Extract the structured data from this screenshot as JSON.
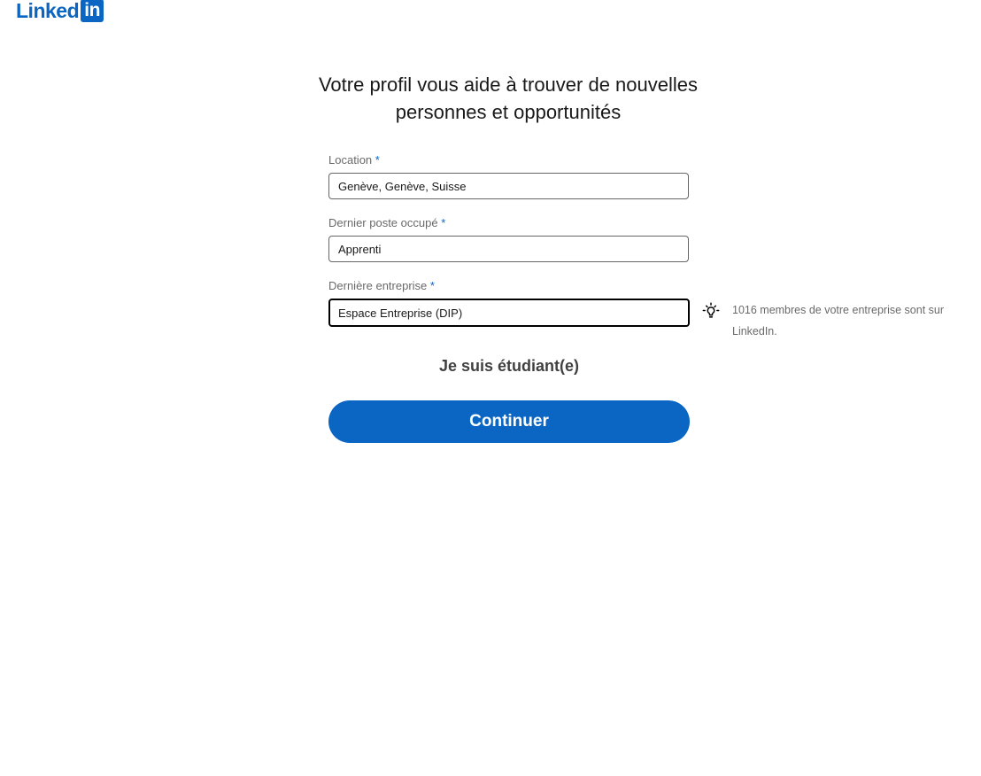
{
  "brand": {
    "word": "Linked",
    "box": "in",
    "color": "#0a66c2"
  },
  "headline": {
    "line1": "Votre profil vous aide à trouver de nouvelles",
    "line2": "personnes et opportunités"
  },
  "form": {
    "location": {
      "label": "Location",
      "required_mark": "*",
      "value": "Genève, Genève, Suisse"
    },
    "job_title": {
      "label": "Dernier poste occupé",
      "required_mark": "*",
      "value": "Apprenti"
    },
    "company": {
      "label": "Dernière entreprise",
      "required_mark": "*",
      "value": "Espace Entreprise (DIP)"
    }
  },
  "hint": {
    "icon": "lightbulb-icon",
    "text": "1016 membres de votre entreprise sont sur LinkedIn."
  },
  "student_link": "Je suis étudiant(e)",
  "continue_label": "Continuer",
  "colors": {
    "primary": "#0a66c2",
    "text": "#000000e6",
    "muted": "#00000099"
  }
}
